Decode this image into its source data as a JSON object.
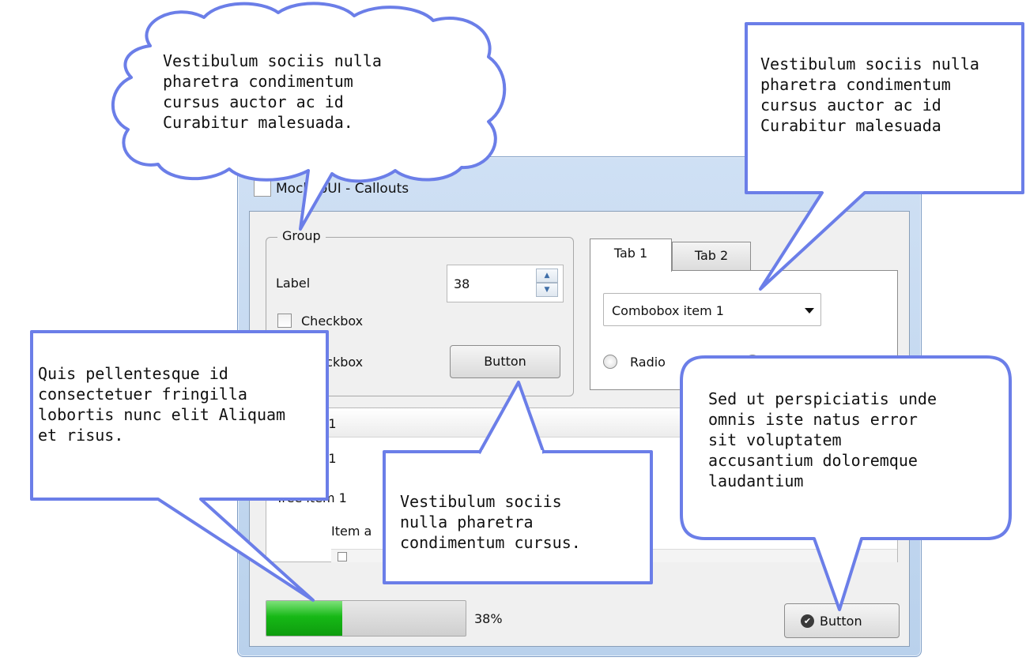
{
  "window": {
    "title": "MockupUI - Callouts"
  },
  "group": {
    "legend": "Group",
    "label": "Label",
    "spin_value": "38",
    "spin_up_icon": "triangle-up",
    "spin_down_icon": "triangle-down",
    "checkbox1": "Checkbox",
    "checkbox2": "Checkbox",
    "button": "Button"
  },
  "tabs": {
    "items": [
      "Tab 1",
      "Tab 2"
    ],
    "active": "Tab 1",
    "combobox_value": "Combobox item 1",
    "radio1": "Radio",
    "radio2": "Radio"
  },
  "tree": {
    "header": "Column 1",
    "subheader": "Column 1",
    "item1": "Tree item 1",
    "item2": "Item a"
  },
  "progress": {
    "value": 0.38,
    "label": "38%"
  },
  "icon_button": {
    "label": "Button",
    "icon": "check-circle"
  },
  "callouts": {
    "cloud": "Vestibulum sociis nulla\npharetra condimentum\ncursus auctor ac id\nCurabitur malesuada.",
    "top_right": "Vestibulum sociis nulla\npharetra condimentum\ncursus auctor ac id\nCurabitur malesuada",
    "left": "Quis pellentesque id\nconsectetuer fringilla\nlobortis nunc elit Aliquam\net risus.",
    "center": "Vestibulum sociis\nnulla pharetra\ncondimentum cursus.",
    "bottom_right": "Sed ut perspiciatis unde\nomnis iste natus error\nsit voluptatem\naccusantium doloremque\nlaudantium"
  },
  "colors": {
    "callout_border": "#6b7ee8",
    "progress_fill": "#16b816",
    "window_frame": "#b9d1ec"
  }
}
